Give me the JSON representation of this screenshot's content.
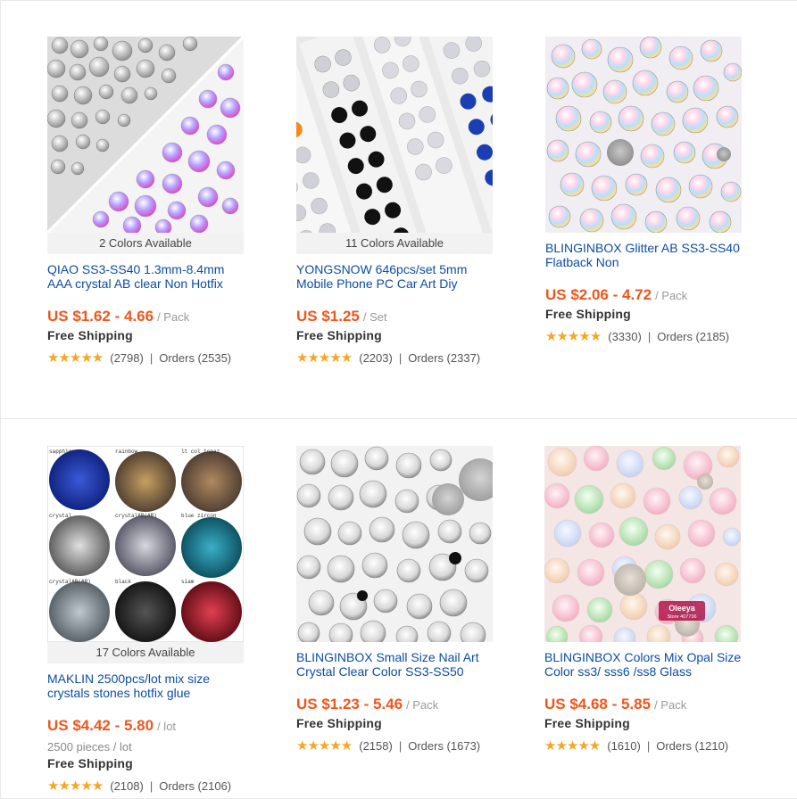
{
  "products": [
    {
      "colors_available": "2 Colors Available",
      "title": "QIAO SS3-SS40 1.3mm-8.4mm AAA crystal AB clear Non Hotfix",
      "price": "US $1.62 - 4.66",
      "unit": "/ Pack",
      "pieces": "",
      "shipping": "Free Shipping",
      "stars": "★★★★★",
      "reviews": "(2798)",
      "sep": "|",
      "orders": "Orders (2535)",
      "image": "split-crystal-ab"
    },
    {
      "colors_available": "11 Colors Available",
      "title": "YONGSNOW 646pcs/set 5mm Mobile Phone PC Car Art Diy",
      "price": "US $1.25",
      "unit": "/ Set",
      "pieces": "",
      "shipping": "Free Shipping",
      "stars": "★★★★★",
      "reviews": "(2203)",
      "sep": "|",
      "orders": "Orders (2337)",
      "image": "sticker-sheets"
    },
    {
      "colors_available": "",
      "title": "BLINGINBOX Glitter AB SS3-SS40 Flatback Non",
      "price": "US $2.06 - 4.72",
      "unit": "/ Pack",
      "pieces": "",
      "shipping": "Free Shipping",
      "stars": "★★★★★",
      "reviews": "(3330)",
      "sep": "|",
      "orders": "Orders (2185)",
      "image": "glitter-ab"
    },
    {
      "colors_available": "17 Colors Available",
      "title": "MAKLIN 2500pcs/lot mix size crystals stones hotfix glue",
      "price": "US $4.42 - 5.80",
      "unit": "/ lot",
      "pieces": "2500 pieces / lot",
      "shipping": "Free Shipping",
      "stars": "★★★★★",
      "reviews": "(2108)",
      "sep": "|",
      "orders": "Orders (2106)",
      "image": "color-grid",
      "grid_labels": [
        "sapphire",
        "rainbow",
        "lt col topaz",
        "crystal",
        "crystalAB(AB)",
        "blue zircon",
        "crystalAB(AB)",
        "black",
        "siam"
      ]
    },
    {
      "colors_available": "",
      "title": "BLINGINBOX Small Size Nail Art Crystal Clear Color SS3-SS50",
      "price": "US $1.23 - 5.46",
      "unit": "/ Pack",
      "pieces": "",
      "shipping": "Free Shipping",
      "stars": "★★★★★",
      "reviews": "(2158)",
      "sep": "|",
      "orders": "Orders (1673)",
      "image": "clear-crystals"
    },
    {
      "colors_available": "",
      "title": "BLINGINBOX Colors Mix Opal Size Color ss3/ sss6 /ss8 Glass",
      "price": "US $4.68 - 5.85",
      "unit": "/ Pack",
      "pieces": "",
      "shipping": "Free Shipping",
      "stars": "★★★★★",
      "reviews": "(1610)",
      "sep": "|",
      "orders": "Orders (1210)",
      "image": "opal-mix",
      "watermark": "Oleeya",
      "watermark_sub": "Store 407736"
    }
  ],
  "colors": {
    "price": "#f0561c",
    "title_link": "#0c4da2",
    "stars": "#f5a623"
  }
}
